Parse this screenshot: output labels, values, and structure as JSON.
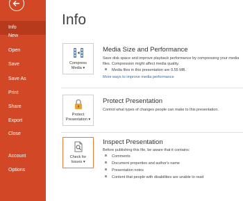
{
  "sidebar": {
    "items": [
      {
        "label": "Info",
        "active": true
      },
      {
        "label": "New"
      },
      {
        "label": "Open"
      },
      {
        "label": "Save"
      },
      {
        "label": "Save As"
      },
      {
        "label": "Print"
      },
      {
        "label": "Share"
      },
      {
        "label": "Export"
      },
      {
        "label": "Close"
      },
      {
        "label": "Account"
      },
      {
        "label": "Options"
      }
    ]
  },
  "main": {
    "title": "Info",
    "media": {
      "button_line1": "Compress",
      "button_line2": "Media ▾",
      "title": "Media Size and Performance",
      "desc_line1": "Save disk space and improve playback performance by compressing your media",
      "desc_line2": "files. Compression might affect media quality.",
      "bullet": "Media files in this presentation are 0.55 MB.",
      "link": "More ways to improve media performance"
    },
    "protect": {
      "button_line1": "Protect",
      "button_line2": "Presentation ▾",
      "title": "Protect Presentation",
      "desc": "Control what types of changes people can make to this presentation."
    },
    "inspect": {
      "button_line1": "Check for",
      "button_line2": "Issues ▾",
      "title": "Inspect Presentation",
      "desc": "Before publishing this file, be aware that it contains:",
      "bullets": [
        "Comments",
        "Document properties and author's name",
        "Presentation notes",
        "Content that people with disabilities are unable to read"
      ]
    }
  },
  "colors": {
    "sidebar": "#d24726",
    "sidebar_active": "#b73a1c",
    "highlight": "#ee7d31",
    "link": "#2e6cb5"
  }
}
